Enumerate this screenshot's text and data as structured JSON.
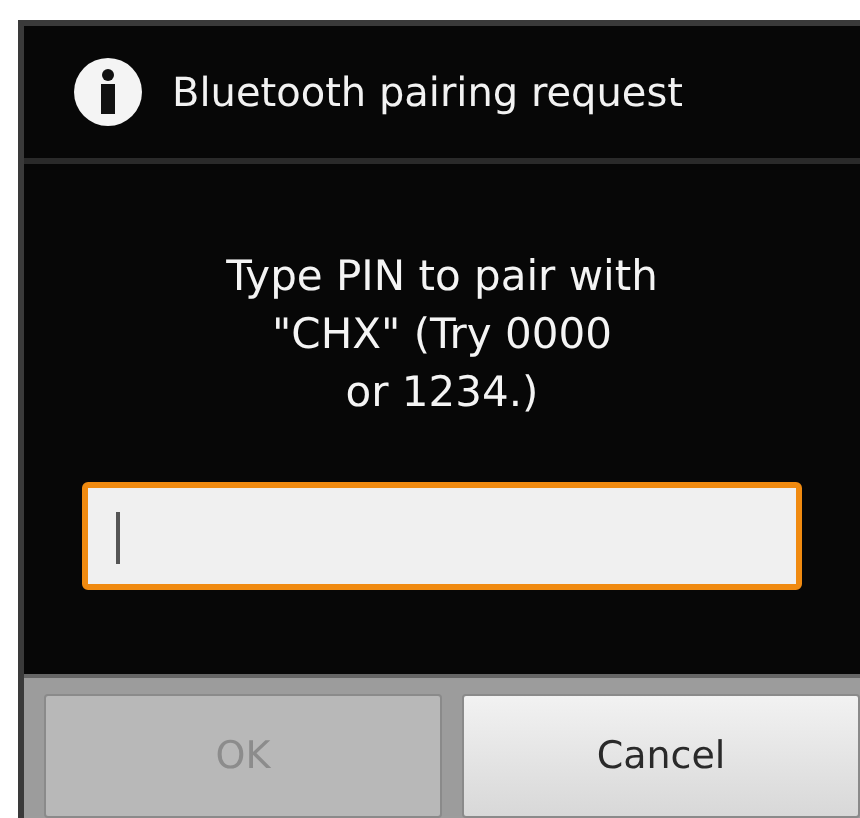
{
  "dialog": {
    "title": "Bluetooth pairing request",
    "message": "Type PIN to pair with\n\"CHX\" (Try 0000\nor 1234.)"
  },
  "pin_field": {
    "focused": true
  },
  "buttons": [
    {
      "label": "OK",
      "disabled": true
    },
    {
      "label": "Cancel",
      "disabled": false
    }
  ]
}
